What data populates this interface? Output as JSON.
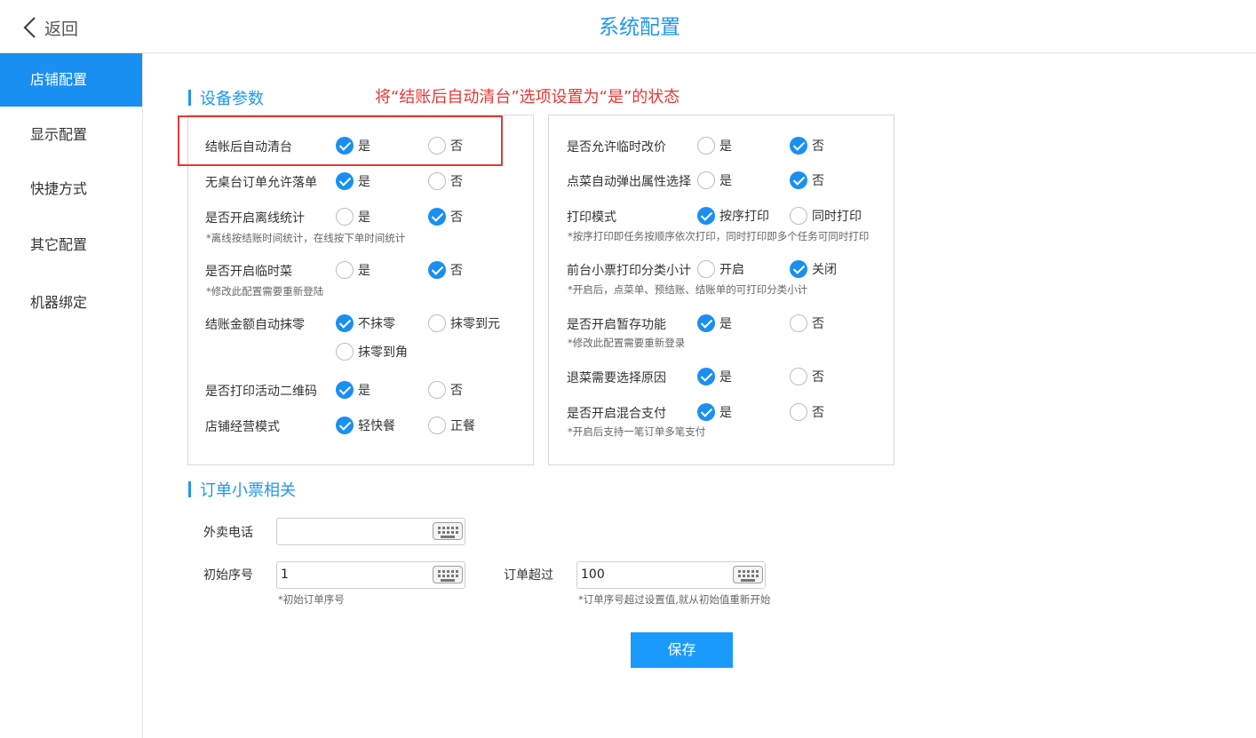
{
  "header": {
    "back_label": "返回",
    "title": "系统配置"
  },
  "sidebar": {
    "items": [
      "店铺配置",
      "显示配置",
      "快捷方式",
      "其它配置",
      "机器绑定"
    ]
  },
  "hint": "将“结账后自动清台”选项设置为“是”的状态",
  "sections": {
    "device": "设备参数",
    "order": "订单小票相关"
  },
  "left_settings": [
    {
      "label": "结帐后自动清台",
      "options": [
        "是",
        "否"
      ],
      "selected": "是"
    },
    {
      "label": "无桌台订单允许落单",
      "options": [
        "是",
        "否"
      ],
      "selected": "是"
    },
    {
      "label": "是否开启离线统计",
      "options": [
        "是",
        "否"
      ],
      "selected": "否",
      "note": "*离线按结账时间统计，在线按下单时间统计"
    },
    {
      "label": "是否开启临时菜",
      "options": [
        "是",
        "否"
      ],
      "selected": "否",
      "note": "*修改此配置需要重新登陆"
    },
    {
      "label": "结账金额自动抹零",
      "options": [
        "不抹零",
        "抹零到元",
        "抹零到角"
      ],
      "selected": "不抹零"
    },
    {
      "label": "是否打印活动二维码",
      "options": [
        "是",
        "否"
      ],
      "selected": "是"
    },
    {
      "label": "店铺经营模式",
      "options": [
        "轻快餐",
        "正餐"
      ],
      "selected": "轻快餐"
    }
  ],
  "right_settings": [
    {
      "label": "是否允许临时改价",
      "options": [
        "是",
        "否"
      ],
      "selected": "否"
    },
    {
      "label": "点菜自动弹出属性选择",
      "options": [
        "是",
        "否"
      ],
      "selected": "否"
    },
    {
      "label": "打印模式",
      "options": [
        "按序打印",
        "同时打印"
      ],
      "selected": "按序打印",
      "note": "*按序打印即任务按顺序依次打印，同时打印即多个任务可同时打印"
    },
    {
      "label": "前台小票打印分类小计",
      "options": [
        "开启",
        "关闭"
      ],
      "selected": "关闭",
      "note": "*开启后，点菜单、预结账、结账单的可打印分类小计"
    },
    {
      "label": "是否开启暂存功能",
      "options": [
        "是",
        "否"
      ],
      "selected": "是",
      "note": "*修改此配置需要重新登录"
    },
    {
      "label": "退菜需要选择原因",
      "options": [
        "是",
        "否"
      ],
      "selected": "是"
    },
    {
      "label": "是否开启混合支付",
      "options": [
        "是",
        "否"
      ],
      "selected": "是",
      "note": "*开启后支持一笔订单多笔支付"
    }
  ],
  "order_fields": {
    "delivery_phone": {
      "label": "外卖电话",
      "value": ""
    },
    "start_seq": {
      "label": "初始序号",
      "value": "1",
      "note": "*初始订单序号"
    },
    "order_exceed": {
      "label": "订单超过",
      "value": "100",
      "note": "*订单序号超过设置值,就从初始值重新开始"
    }
  },
  "save_label": "保存",
  "colors": {
    "accent": "#1a8ff2",
    "hint": "#e53935"
  }
}
